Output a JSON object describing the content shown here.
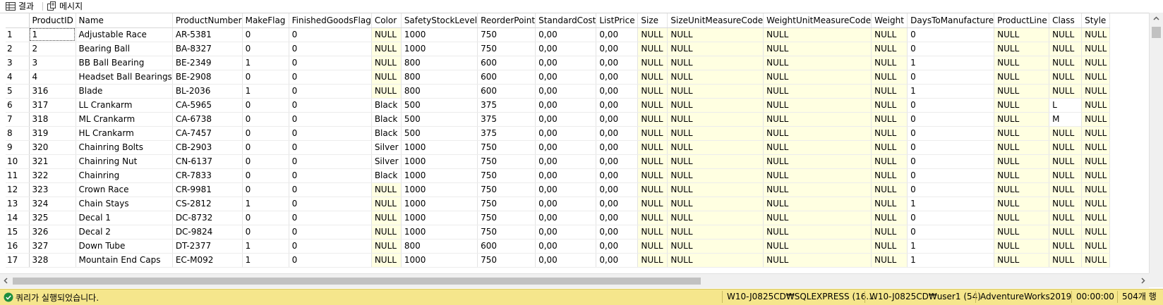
{
  "tabs": [
    {
      "label": "결과",
      "icon": "grid-icon"
    },
    {
      "label": "메시지",
      "icon": "message-icon"
    }
  ],
  "grid": {
    "columns": [
      "ProductID",
      "Name",
      "ProductNumber",
      "MakeFlag",
      "FinishedGoodsFlag",
      "Color",
      "SafetyStockLevel",
      "ReorderPoint",
      "StandardCost",
      "ListPrice",
      "Size",
      "SizeUnitMeasureCode",
      "WeightUnitMeasureCode",
      "Weight",
      "DaysToManufacture",
      "ProductLine",
      "Class",
      "Style"
    ],
    "rows": [
      {
        "n": "1",
        "cells": [
          "1",
          "Adjustable Race",
          "AR-5381",
          "0",
          "0",
          "NULL",
          "1000",
          "750",
          "0,00",
          "0,00",
          "NULL",
          "NULL",
          "NULL",
          "NULL",
          "0",
          "NULL",
          "NULL",
          "NULL"
        ]
      },
      {
        "n": "2",
        "cells": [
          "2",
          "Bearing Ball",
          "BA-8327",
          "0",
          "0",
          "NULL",
          "1000",
          "750",
          "0,00",
          "0,00",
          "NULL",
          "NULL",
          "NULL",
          "NULL",
          "0",
          "NULL",
          "NULL",
          "NULL"
        ]
      },
      {
        "n": "3",
        "cells": [
          "3",
          "BB Ball Bearing",
          "BE-2349",
          "1",
          "0",
          "NULL",
          "800",
          "600",
          "0,00",
          "0,00",
          "NULL",
          "NULL",
          "NULL",
          "NULL",
          "1",
          "NULL",
          "NULL",
          "NULL"
        ]
      },
      {
        "n": "4",
        "cells": [
          "4",
          "Headset Ball Bearings",
          "BE-2908",
          "0",
          "0",
          "NULL",
          "800",
          "600",
          "0,00",
          "0,00",
          "NULL",
          "NULL",
          "NULL",
          "NULL",
          "0",
          "NULL",
          "NULL",
          "NULL"
        ]
      },
      {
        "n": "5",
        "cells": [
          "316",
          "Blade",
          "BL-2036",
          "1",
          "0",
          "NULL",
          "800",
          "600",
          "0,00",
          "0,00",
          "NULL",
          "NULL",
          "NULL",
          "NULL",
          "1",
          "NULL",
          "NULL",
          "NULL"
        ]
      },
      {
        "n": "6",
        "cells": [
          "317",
          "LL Crankarm",
          "CA-5965",
          "0",
          "0",
          "Black",
          "500",
          "375",
          "0,00",
          "0,00",
          "NULL",
          "NULL",
          "NULL",
          "NULL",
          "0",
          "NULL",
          "L",
          "NULL"
        ]
      },
      {
        "n": "7",
        "cells": [
          "318",
          "ML Crankarm",
          "CA-6738",
          "0",
          "0",
          "Black",
          "500",
          "375",
          "0,00",
          "0,00",
          "NULL",
          "NULL",
          "NULL",
          "NULL",
          "0",
          "NULL",
          "M",
          "NULL"
        ]
      },
      {
        "n": "8",
        "cells": [
          "319",
          "HL Crankarm",
          "CA-7457",
          "0",
          "0",
          "Black",
          "500",
          "375",
          "0,00",
          "0,00",
          "NULL",
          "NULL",
          "NULL",
          "NULL",
          "0",
          "NULL",
          "NULL",
          "NULL"
        ]
      },
      {
        "n": "9",
        "cells": [
          "320",
          "Chainring Bolts",
          "CB-2903",
          "0",
          "0",
          "Silver",
          "1000",
          "750",
          "0,00",
          "0,00",
          "NULL",
          "NULL",
          "NULL",
          "NULL",
          "0",
          "NULL",
          "NULL",
          "NULL"
        ]
      },
      {
        "n": "10",
        "cells": [
          "321",
          "Chainring Nut",
          "CN-6137",
          "0",
          "0",
          "Silver",
          "1000",
          "750",
          "0,00",
          "0,00",
          "NULL",
          "NULL",
          "NULL",
          "NULL",
          "0",
          "NULL",
          "NULL",
          "NULL"
        ]
      },
      {
        "n": "11",
        "cells": [
          "322",
          "Chainring",
          "CR-7833",
          "0",
          "0",
          "Black",
          "1000",
          "750",
          "0,00",
          "0,00",
          "NULL",
          "NULL",
          "NULL",
          "NULL",
          "0",
          "NULL",
          "NULL",
          "NULL"
        ]
      },
      {
        "n": "12",
        "cells": [
          "323",
          "Crown Race",
          "CR-9981",
          "0",
          "0",
          "NULL",
          "1000",
          "750",
          "0,00",
          "0,00",
          "NULL",
          "NULL",
          "NULL",
          "NULL",
          "0",
          "NULL",
          "NULL",
          "NULL"
        ]
      },
      {
        "n": "13",
        "cells": [
          "324",
          "Chain Stays",
          "CS-2812",
          "1",
          "0",
          "NULL",
          "1000",
          "750",
          "0,00",
          "0,00",
          "NULL",
          "NULL",
          "NULL",
          "NULL",
          "1",
          "NULL",
          "NULL",
          "NULL"
        ]
      },
      {
        "n": "14",
        "cells": [
          "325",
          "Decal 1",
          "DC-8732",
          "0",
          "0",
          "NULL",
          "1000",
          "750",
          "0,00",
          "0,00",
          "NULL",
          "NULL",
          "NULL",
          "NULL",
          "0",
          "NULL",
          "NULL",
          "NULL"
        ]
      },
      {
        "n": "15",
        "cells": [
          "326",
          "Decal 2",
          "DC-9824",
          "0",
          "0",
          "NULL",
          "1000",
          "750",
          "0,00",
          "0,00",
          "NULL",
          "NULL",
          "NULL",
          "NULL",
          "0",
          "NULL",
          "NULL",
          "NULL"
        ]
      },
      {
        "n": "16",
        "cells": [
          "327",
          "Down Tube",
          "DT-2377",
          "1",
          "0",
          "NULL",
          "800",
          "600",
          "0,00",
          "0,00",
          "NULL",
          "NULL",
          "NULL",
          "NULL",
          "1",
          "NULL",
          "NULL",
          "NULL"
        ]
      },
      {
        "n": "17",
        "cells": [
          "328",
          "Mountain End Caps",
          "EC-M092",
          "1",
          "0",
          "NULL",
          "1000",
          "750",
          "0,00",
          "0,00",
          "NULL",
          "NULL",
          "NULL",
          "NULL",
          "1",
          "NULL",
          "NULL",
          "NULL"
        ]
      }
    ]
  },
  "status": {
    "message": "쿼리가 실행되었습니다.",
    "server": "W10-J0825CD₩SQLEXPRESS (16....",
    "user": "W10-J0825CD₩user1 (54)",
    "database": "AdventureWorks2019",
    "elapsed": "00:00:00",
    "row_count": "504개 행"
  },
  "colors": {
    "status_bar": "#f5e68c",
    "null_cell": "#ffffe1",
    "ok_icon": "#1e8e3e"
  }
}
